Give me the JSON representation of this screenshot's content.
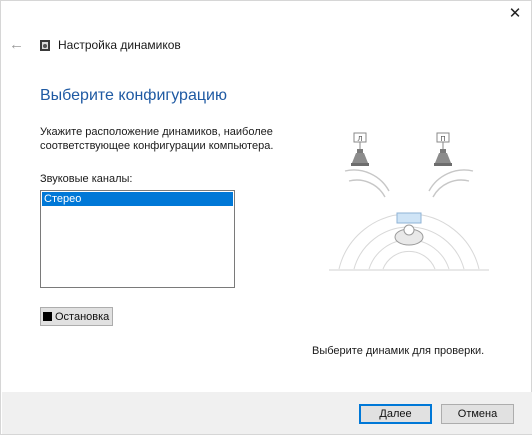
{
  "window": {
    "title": "Настройка динамиков",
    "close_glyph": "✕",
    "back_glyph": "←"
  },
  "page": {
    "heading": "Выберите конфигурацию",
    "description": "Укажите расположение динамиков, наиболее соответствующее конфигурации компьютера.",
    "channels_label": "Звуковые каналы:",
    "channels": [
      {
        "label": "Стерео",
        "selected": true
      }
    ],
    "test_button": "Остановка",
    "test_hint": "Выберите динамик для проверки."
  },
  "diagram": {
    "left_speaker_label": "Л",
    "right_speaker_label": "П"
  },
  "buttons": {
    "next": "Далее",
    "cancel": "Отмена"
  },
  "colors": {
    "heading": "#1f5aa3",
    "selection": "#0078d7",
    "footer": "#f0f0f0"
  }
}
